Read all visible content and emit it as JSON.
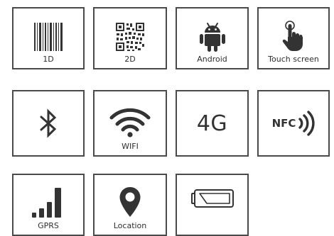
{
  "tiles": [
    {
      "label": "1D",
      "icon": "barcode-icon"
    },
    {
      "label": "2D",
      "icon": "qr-code-icon"
    },
    {
      "label": "Android",
      "icon": "android-icon"
    },
    {
      "label": "Touch screen",
      "icon": "touch-hand-icon"
    },
    {
      "label": "",
      "icon": "bluetooth-icon"
    },
    {
      "label": "WIFI",
      "icon": "wifi-icon"
    },
    {
      "label": "",
      "icon": "4g-text-icon",
      "text": "4G"
    },
    {
      "label": "",
      "icon": "nfc-icon",
      "text": "NFC"
    },
    {
      "label": "GPRS",
      "icon": "signal-bars-icon"
    },
    {
      "label": "Location",
      "icon": "location-pin-icon"
    },
    {
      "label": "",
      "icon": "battery-icon"
    }
  ],
  "colors": {
    "border": "#4a4a4a",
    "icon": "#333333",
    "background": "#ffffff"
  }
}
